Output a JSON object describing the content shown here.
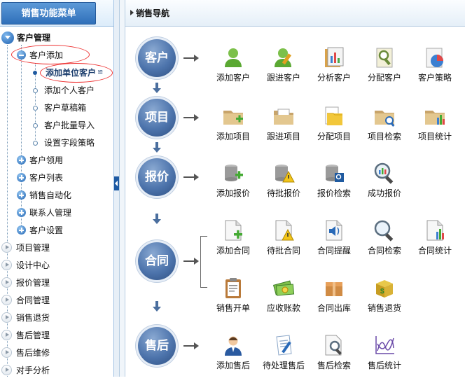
{
  "sidebar": {
    "title": "销售功能菜单",
    "root": "客户管理",
    "expanded": "客户添加",
    "sub_items": [
      "添加单位客户",
      "添加个人客户",
      "客户草稿箱",
      "客户批量导入",
      "设置字段策略"
    ],
    "selected_suffix": "≌",
    "groups": [
      "客户领用",
      "客户列表",
      "销售自动化",
      "联系人管理",
      "客户设置"
    ],
    "modules": [
      "项目管理",
      "设计中心",
      "报价管理",
      "合同管理",
      "销售退货",
      "售后管理",
      "售后维修",
      "对手分析"
    ]
  },
  "main": {
    "title": "销售导航",
    "categories": [
      "客户",
      "项目",
      "报价",
      "合同",
      "售后"
    ],
    "rows": [
      [
        "添加客户",
        "跟进客户",
        "分析客户",
        "分配客户",
        "客户策略"
      ],
      [
        "添加项目",
        "跟进项目",
        "分配项目",
        "项目检索",
        "项目统计"
      ],
      [
        "添加报价",
        "待批报价",
        "报价检索",
        "成功报价"
      ],
      [
        "添加合同",
        "待批合同",
        "合同提醒",
        "合同检索",
        "合同统计"
      ],
      [
        "销售开单",
        "应收账款",
        "合同出库",
        "销售退货"
      ],
      [
        "添加售后",
        "待处理售后",
        "售后检索",
        "售后统计"
      ]
    ]
  },
  "colors": {
    "accent": "#2f6fb9",
    "category": "#4d74ac",
    "highlight": "#ee3333"
  }
}
